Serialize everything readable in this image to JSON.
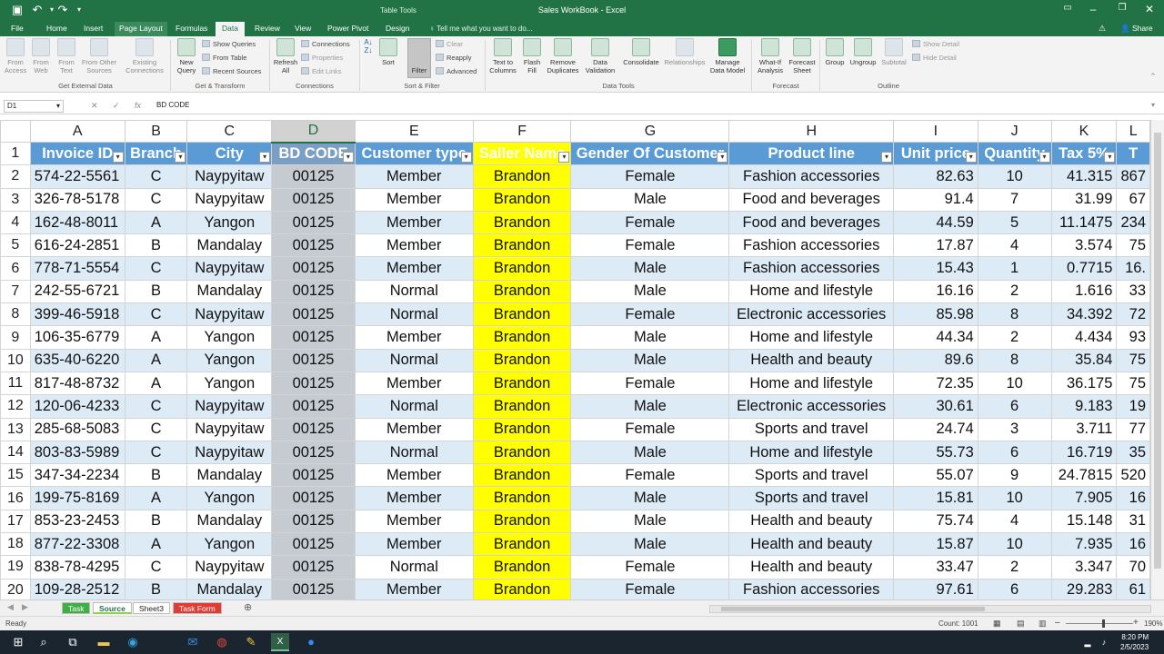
{
  "window": {
    "title": "Sales WorkBook - Excel",
    "context_tab_group": "Table Tools"
  },
  "tabs": [
    {
      "label": "File"
    },
    {
      "label": "Home"
    },
    {
      "label": "Insert"
    },
    {
      "label": "Page Layout"
    },
    {
      "label": "Formulas"
    },
    {
      "label": "Data"
    },
    {
      "label": "Review"
    },
    {
      "label": "View"
    },
    {
      "label": "Power Pivot"
    },
    {
      "label": "Design"
    }
  ],
  "tell_me": "Tell me what you want to do...",
  "share_label": "Share",
  "ribbon": {
    "get_external": {
      "from_access": "From Access",
      "from_web": "From Web",
      "from_text": "From Text",
      "from_other": "From Other Sources",
      "existing": "Existing Connections",
      "group": "Get External Data"
    },
    "get_transform": {
      "new_query": "New Query",
      "show_queries": "Show Queries",
      "from_table": "From Table",
      "recent_sources": "Recent Sources",
      "group": "Get & Transform"
    },
    "connections": {
      "refresh_all": "Refresh All",
      "connections": "Connections",
      "properties": "Properties",
      "edit_links": "Edit Links",
      "group": "Connections"
    },
    "sort_filter": {
      "sort": "Sort",
      "filter": "Filter",
      "clear": "Clear",
      "reapply": "Reapply",
      "advanced": "Advanced",
      "group": "Sort & Filter"
    },
    "data_tools": {
      "text_to_columns": "Text to Columns",
      "flash_fill": "Flash Fill",
      "remove_dup": "Remove Duplicates",
      "data_validation": "Data Validation",
      "consolidate": "Consolidate",
      "relationships": "Relationships",
      "manage_model": "Manage Data Model",
      "group": "Data Tools"
    },
    "forecast": {
      "what_if": "What-If Analysis",
      "forecast_sheet": "Forecast Sheet",
      "group": "Forecast"
    },
    "outline": {
      "group_btn": "Group",
      "ungroup": "Ungroup",
      "subtotal": "Subtotal",
      "show_detail": "Show Detail",
      "hide_detail": "Hide Detail",
      "group": "Outline"
    }
  },
  "name_box": "D1",
  "formula_content": "BD CODE",
  "columns": [
    "A",
    "B",
    "C",
    "D",
    "E",
    "F",
    "G",
    "H",
    "I",
    "J",
    "K",
    "L"
  ],
  "table_headers": [
    "Invoice ID",
    "Branch",
    "City",
    "BD CODE",
    "Customer type",
    "Saller Name",
    "Gender Of Customer",
    "Product line",
    "Unit price",
    "Quantity",
    "Tax 5%",
    "T"
  ],
  "rows": [
    {
      "n": "2",
      "cells": [
        "574-22-5561",
        "C",
        "Naypyitaw",
        "00125",
        "Member",
        "Brandon",
        "Female",
        "Fashion accessories",
        "82.63",
        "10",
        "41.315",
        "867"
      ]
    },
    {
      "n": "3",
      "cells": [
        "326-78-5178",
        "C",
        "Naypyitaw",
        "00125",
        "Member",
        "Brandon",
        "Male",
        "Food and beverages",
        "91.4",
        "7",
        "31.99",
        "67"
      ]
    },
    {
      "n": "4",
      "cells": [
        "162-48-8011",
        "A",
        "Yangon",
        "00125",
        "Member",
        "Brandon",
        "Female",
        "Food and beverages",
        "44.59",
        "5",
        "11.1475",
        "234"
      ]
    },
    {
      "n": "5",
      "cells": [
        "616-24-2851",
        "B",
        "Mandalay",
        "00125",
        "Member",
        "Brandon",
        "Female",
        "Fashion accessories",
        "17.87",
        "4",
        "3.574",
        "75"
      ]
    },
    {
      "n": "6",
      "cells": [
        "778-71-5554",
        "C",
        "Naypyitaw",
        "00125",
        "Member",
        "Brandon",
        "Male",
        "Fashion accessories",
        "15.43",
        "1",
        "0.7715",
        "16."
      ]
    },
    {
      "n": "7",
      "cells": [
        "242-55-6721",
        "B",
        "Mandalay",
        "00125",
        "Normal",
        "Brandon",
        "Male",
        "Home and lifestyle",
        "16.16",
        "2",
        "1.616",
        "33"
      ]
    },
    {
      "n": "8",
      "cells": [
        "399-46-5918",
        "C",
        "Naypyitaw",
        "00125",
        "Normal",
        "Brandon",
        "Female",
        "Electronic accessories",
        "85.98",
        "8",
        "34.392",
        "72"
      ]
    },
    {
      "n": "9",
      "cells": [
        "106-35-6779",
        "A",
        "Yangon",
        "00125",
        "Member",
        "Brandon",
        "Male",
        "Home and lifestyle",
        "44.34",
        "2",
        "4.434",
        "93"
      ]
    },
    {
      "n": "10",
      "cells": [
        "635-40-6220",
        "A",
        "Yangon",
        "00125",
        "Normal",
        "Brandon",
        "Male",
        "Health and beauty",
        "89.6",
        "8",
        "35.84",
        "75"
      ]
    },
    {
      "n": "11",
      "cells": [
        "817-48-8732",
        "A",
        "Yangon",
        "00125",
        "Member",
        "Brandon",
        "Female",
        "Home and lifestyle",
        "72.35",
        "10",
        "36.175",
        "75"
      ]
    },
    {
      "n": "12",
      "cells": [
        "120-06-4233",
        "C",
        "Naypyitaw",
        "00125",
        "Normal",
        "Brandon",
        "Male",
        "Electronic accessories",
        "30.61",
        "6",
        "9.183",
        "19"
      ]
    },
    {
      "n": "13",
      "cells": [
        "285-68-5083",
        "C",
        "Naypyitaw",
        "00125",
        "Member",
        "Brandon",
        "Female",
        "Sports and travel",
        "24.74",
        "3",
        "3.711",
        "77"
      ]
    },
    {
      "n": "14",
      "cells": [
        "803-83-5989",
        "C",
        "Naypyitaw",
        "00125",
        "Normal",
        "Brandon",
        "Male",
        "Home and lifestyle",
        "55.73",
        "6",
        "16.719",
        "35"
      ]
    },
    {
      "n": "15",
      "cells": [
        "347-34-2234",
        "B",
        "Mandalay",
        "00125",
        "Member",
        "Brandon",
        "Female",
        "Sports and travel",
        "55.07",
        "9",
        "24.7815",
        "520"
      ]
    },
    {
      "n": "16",
      "cells": [
        "199-75-8169",
        "A",
        "Yangon",
        "00125",
        "Member",
        "Brandon",
        "Male",
        "Sports and travel",
        "15.81",
        "10",
        "7.905",
        "16"
      ]
    },
    {
      "n": "17",
      "cells": [
        "853-23-2453",
        "B",
        "Mandalay",
        "00125",
        "Member",
        "Brandon",
        "Male",
        "Health and beauty",
        "75.74",
        "4",
        "15.148",
        "31"
      ]
    },
    {
      "n": "18",
      "cells": [
        "877-22-3308",
        "A",
        "Yangon",
        "00125",
        "Member",
        "Brandon",
        "Male",
        "Health and beauty",
        "15.87",
        "10",
        "7.935",
        "16"
      ]
    },
    {
      "n": "19",
      "cells": [
        "838-78-4295",
        "C",
        "Naypyitaw",
        "00125",
        "Normal",
        "Brandon",
        "Female",
        "Health and beauty",
        "33.47",
        "2",
        "3.347",
        "70"
      ]
    },
    {
      "n": "20",
      "cells": [
        "109-28-2512",
        "B",
        "Mandalay",
        "00125",
        "Member",
        "Brandon",
        "Female",
        "Fashion accessories",
        "97.61",
        "6",
        "29.283",
        "61"
      ]
    }
  ],
  "sheets": [
    {
      "label": "Task",
      "color": "#3cb043"
    },
    {
      "label": "Source",
      "color": "#92d050"
    },
    {
      "label": "Sheet3",
      "color": "#ffffff"
    },
    {
      "label": "Task Form",
      "color": "#e03c31"
    }
  ],
  "status": {
    "ready": "Ready",
    "count": "Count: 1001",
    "zoom": "190%"
  },
  "clock": {
    "time": "8:20 PM",
    "date": "2/5/2023"
  },
  "colors": {
    "excel_green": "#217346",
    "table_header": "#5b9bd5",
    "band": "#ddebf7",
    "highlight": "#ffff00"
  }
}
